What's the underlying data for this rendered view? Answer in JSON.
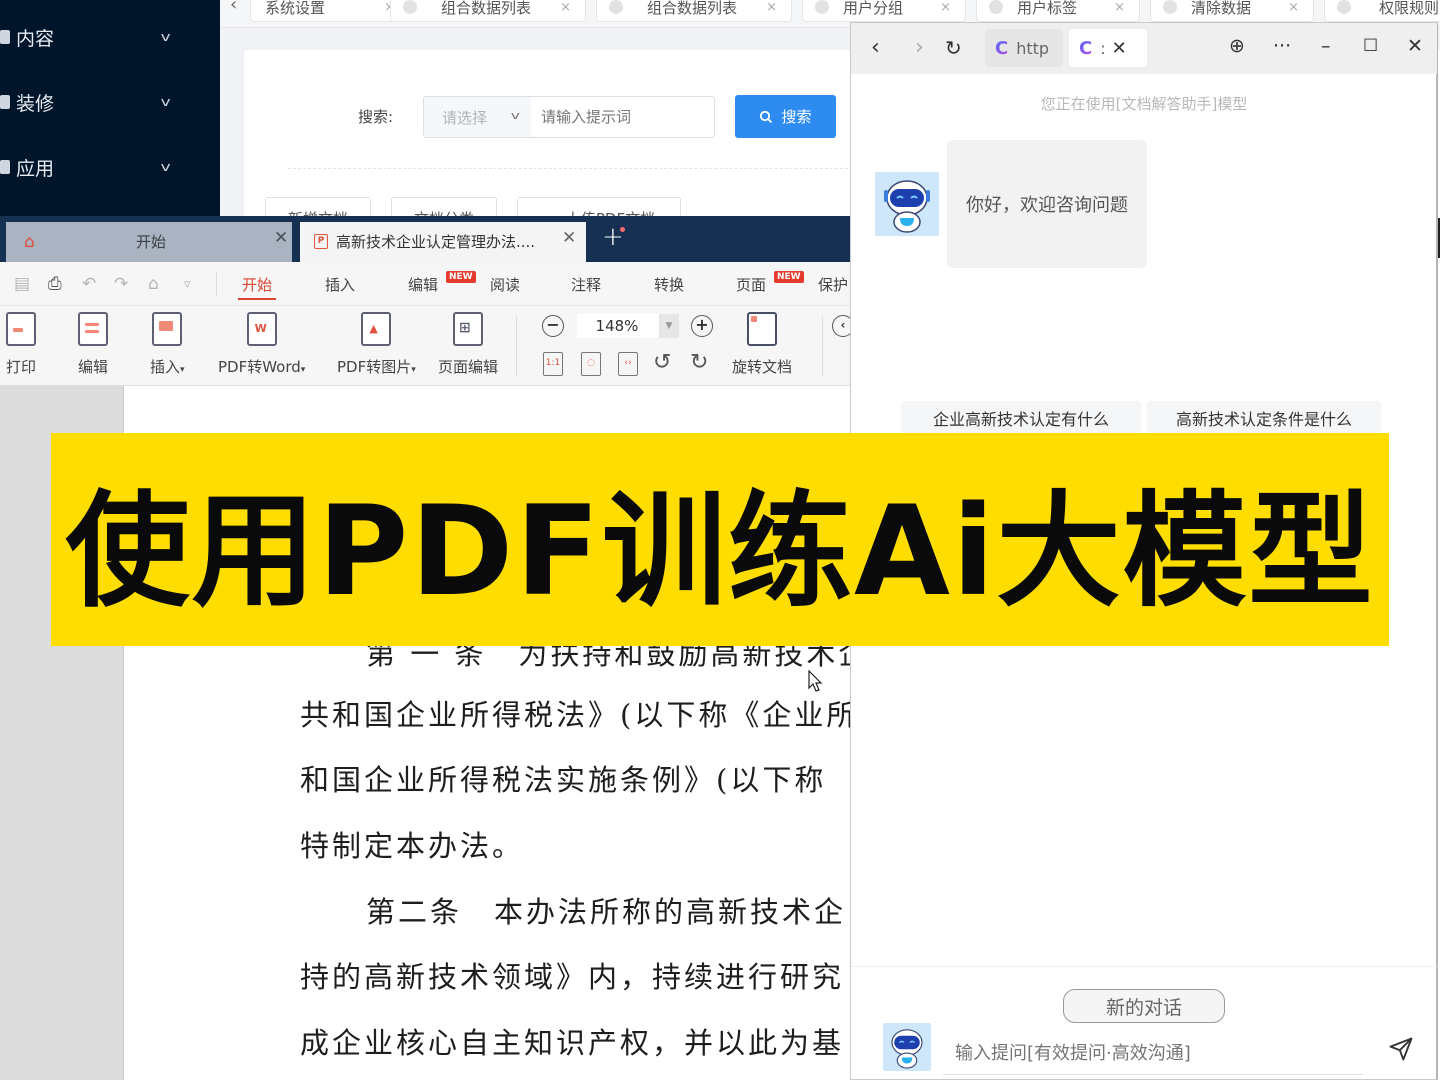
{
  "admin": {
    "sidebar": {
      "items": [
        {
          "label": "内容",
          "icon": "content-icon"
        },
        {
          "label": "装修",
          "icon": "decoration-icon"
        },
        {
          "label": "应用",
          "icon": "apps-icon"
        }
      ]
    },
    "tabs": [
      {
        "label": "系统设置"
      },
      {
        "label": "组合数据列表"
      },
      {
        "label": "组合数据列表"
      },
      {
        "label": "用户分组"
      },
      {
        "label": "用户标签"
      },
      {
        "label": "清除数据"
      },
      {
        "label": "权限规则"
      }
    ],
    "search": {
      "label": "搜索:",
      "select_placeholder": "请选择",
      "input_placeholder": "请输入提示词",
      "button_label": "搜索"
    },
    "actions": [
      "新增文档",
      "文档分类",
      "上传PDF文档"
    ]
  },
  "wps": {
    "tabs": {
      "home_label": "开始",
      "doc_label": "高新技术企业认定管理办法...."
    },
    "menu": [
      {
        "label": "开始",
        "active": true
      },
      {
        "label": "插入"
      },
      {
        "label": "编辑",
        "badge": "NEW"
      },
      {
        "label": "阅读"
      },
      {
        "label": "注释"
      },
      {
        "label": "转换"
      },
      {
        "label": "页面",
        "badge": "NEW"
      },
      {
        "label": "保护"
      }
    ],
    "ribbon": {
      "print": "打印",
      "edit": "编辑",
      "insert": "插入",
      "pdf_to_word": "PDF转Word",
      "pdf_to_image": "PDF转图片",
      "page_edit": "页面编辑",
      "zoom_value": "148%",
      "rotate_doc": "旋转文档"
    },
    "document": {
      "lines": [
        "第 一 条　为扶持和鼓励高新技术企",
        "共和国企业所得税法》(以下称《企业所",
        "和国企业所得税法实施条例》(以下称",
        "特制定本办法。",
        "第二条　本办法所称的高新技术企",
        "持的高新技术领域》内，持续进行研究",
        "成企业核心自主知识产权，并以此为基"
      ]
    }
  },
  "chat": {
    "browser": {
      "tab1_text": "http",
      "tab2_text": ":"
    },
    "model_hint": "您正在使用[文档解答助手]模型",
    "welcome_message": "你好，欢迎咨询问题",
    "suggestions": [
      "企业高新技术认定有什么",
      "高新技术认定条件是什么"
    ],
    "new_chat_label": "新的对话",
    "input_placeholder": "输入提问[有效提问·高效沟通]"
  },
  "banner": {
    "title": "使用PDF训练Ai大模型",
    "color": "#ffdd00"
  }
}
